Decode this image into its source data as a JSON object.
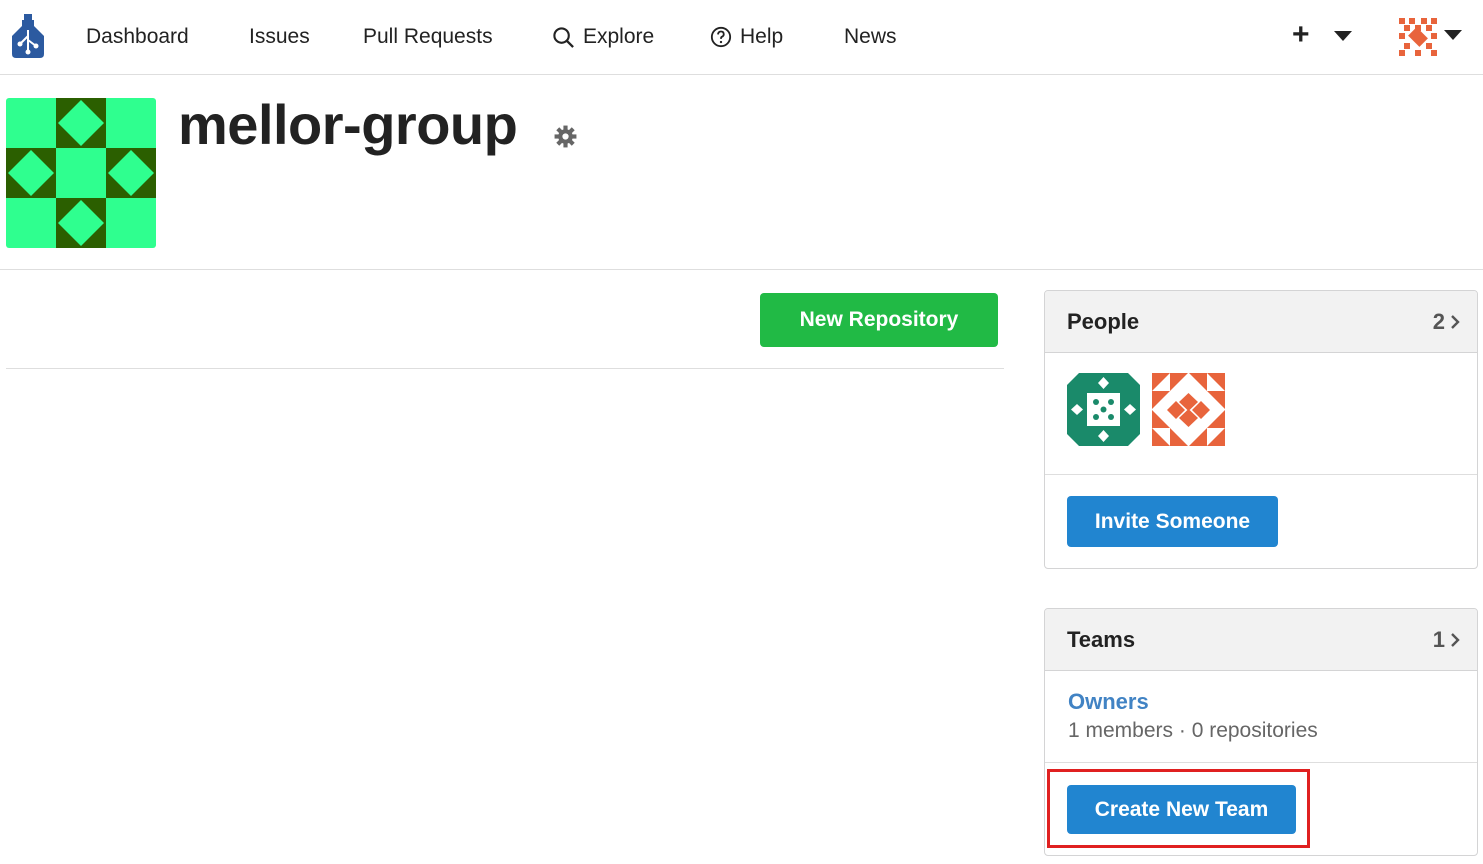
{
  "nav": {
    "items": [
      {
        "label": "Dashboard"
      },
      {
        "label": "Issues"
      },
      {
        "label": "Pull Requests"
      },
      {
        "label": "Explore",
        "icon": "search-icon"
      },
      {
        "label": "Help",
        "icon": "help-circle-icon"
      },
      {
        "label": "News"
      }
    ],
    "plus_label": "+",
    "logo_icon": "gitea-logo-icon"
  },
  "org": {
    "name": "mellor-group",
    "avatar_colors": {
      "light": "#2fff8f",
      "dark": "#2b5f00"
    }
  },
  "repos": {
    "new_repo_label": "New Repository"
  },
  "people": {
    "title": "People",
    "count": "2",
    "members": [
      {
        "avatar": "member-avatar-green",
        "color": "#1a8a6a"
      },
      {
        "avatar": "member-avatar-orange",
        "color": "#e8643c"
      }
    ],
    "invite_label": "Invite Someone"
  },
  "teams": {
    "title": "Teams",
    "count": "1",
    "items": [
      {
        "name": "Owners",
        "meta": "1 members · 0 repositories"
      }
    ],
    "create_label": "Create New Team"
  },
  "colors": {
    "green_button": "#21ba45",
    "blue_button": "#2185d0",
    "link": "#4183c4",
    "highlight": "#e02020"
  }
}
